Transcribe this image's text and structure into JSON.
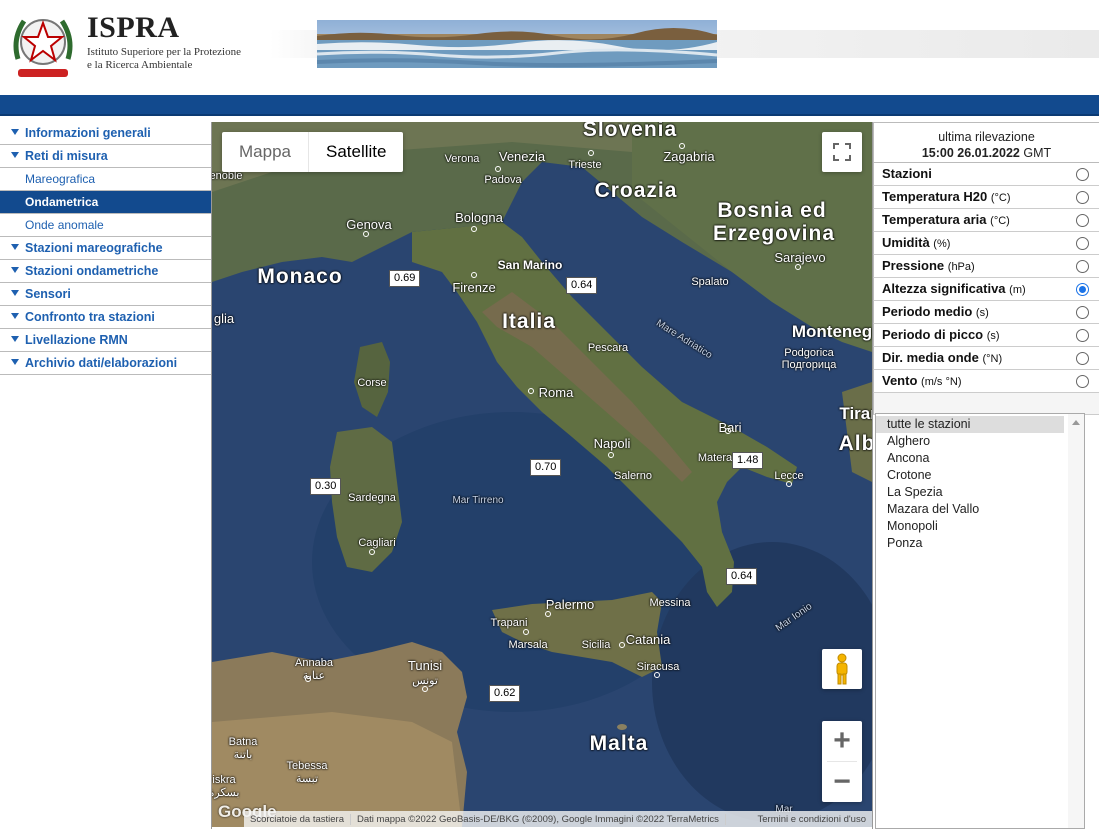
{
  "header": {
    "brand_name": "ISPRA",
    "brand_sub_line1": "Istituto Superiore per la Protezione",
    "brand_sub_line2": "e la Ricerca Ambientale",
    "logo_icon": "italian-republic-emblem"
  },
  "sidebar": {
    "items": [
      {
        "label": "Informazioni generali"
      },
      {
        "label": "Reti di misura"
      }
    ],
    "sub_items": [
      {
        "label": "Mareografica"
      },
      {
        "label": "Ondametrica"
      },
      {
        "label": "Onde anomale"
      }
    ],
    "items_after": [
      {
        "label": "Stazioni mareografiche"
      },
      {
        "label": "Stazioni ondametriche"
      },
      {
        "label": "Sensori"
      },
      {
        "label": "Confronto tra stazioni"
      },
      {
        "label": "Livellazione RMN"
      },
      {
        "label": "Archivio dati/elaborazioni"
      }
    ]
  },
  "map": {
    "type_map": "Mappa",
    "type_satellite": "Satellite",
    "countries": {
      "slovenia": "Slovenia",
      "croazia": "Croazia",
      "bosnia1": "Bosnia ed",
      "bosnia2": "Erzegovina",
      "monaco": "Monaco",
      "italia": "Italia",
      "montenegro": "Monteneg",
      "malta": "Malta",
      "tirana": "Tiran",
      "albania": "Alb",
      "glia": "glia",
      "enoble": "enoble"
    },
    "cities": {
      "verona": "Verona",
      "venezia": "Venezia",
      "padova": "Padova",
      "trieste": "Trieste",
      "zagabria": "Zagabria",
      "genova": "Genova",
      "bologna": "Bologna",
      "sanmarino": "San Marino",
      "firenze": "Firenze",
      "sarajevo": "Sarajevo",
      "spalato": "Spalato",
      "pescara": "Pescara",
      "roma": "Roma",
      "podgorica1": "Podgorica",
      "podgorica2": "Подгорица",
      "corse": "Corse",
      "bari": "Bari",
      "napoli": "Napoli",
      "matera": "Matera",
      "salerno": "Salerno",
      "lecce": "Lecce",
      "sardegna": "Sardegna",
      "cagliari": "Cagliari",
      "palermo": "Palermo",
      "messina": "Messina",
      "trapani": "Trapani",
      "marsala": "Marsala",
      "sicilia": "Sicilia",
      "catania": "Catania",
      "siracusa": "Siracusa",
      "annaba1": "Annaba",
      "annaba2": "عنابة",
      "tunisi": "Tunisi",
      "tunisi_ar": "تونس",
      "batna1": "Batna",
      "batna2": "باتنة",
      "tebessa1": "Tebessa",
      "tebessa2": "تبسة",
      "biskra1": "iskra",
      "biskra2": "بسكرة"
    },
    "seas": {
      "adriatico": "Mare Adriatico",
      "tirreno": "Mar Tirreno",
      "ionio": "Mar Ionio",
      "mar_bottom": "Mar"
    },
    "values": {
      "v1": "0.69",
      "v2": "0.64",
      "v3": "0.30",
      "v4": "0.70",
      "v5": "1.48",
      "v6": "0.64",
      "v7": "0.62"
    },
    "google_logo": "Google",
    "attribution": {
      "shortcuts": "Scorciatoie da tastiera",
      "data": "Dati mappa ©2022 GeoBasis-DE/BKG (©2009), Google Immagini ©2022 TerraMetrics",
      "terms": "Termini e condizioni d'uso"
    }
  },
  "panel": {
    "last_update_label": "ultima rilevazione",
    "last_update_time": "15:00 26.01.2022",
    "last_update_tz": "GMT",
    "params": [
      {
        "label": "Stazioni",
        "unit": ""
      },
      {
        "label": "Temperatura H20",
        "unit": "(°C)"
      },
      {
        "label": "Temperatura aria",
        "unit": "(°C)"
      },
      {
        "label": "Umidità",
        "unit": "(%)"
      },
      {
        "label": "Pressione",
        "unit": "(hPa)"
      },
      {
        "label": "Altezza significativa",
        "unit": "(m)"
      },
      {
        "label": "Periodo medio",
        "unit": "(s)"
      },
      {
        "label": "Periodo di picco",
        "unit": "(s)"
      },
      {
        "label": "Dir. media onde",
        "unit": "(°N)"
      },
      {
        "label": "Vento",
        "unit": "(m/s °N)"
      }
    ],
    "stations": [
      "tutte le stazioni",
      "Alghero",
      "Ancona",
      "Crotone",
      "La Spezia",
      "Mazara del Vallo",
      "Monopoli",
      "Ponza"
    ]
  },
  "colors": {
    "brand_blue": "#124a8e",
    "link_blue": "#1e60b0",
    "sea": "#2b4670",
    "radio_checked": "#1a73e8"
  }
}
